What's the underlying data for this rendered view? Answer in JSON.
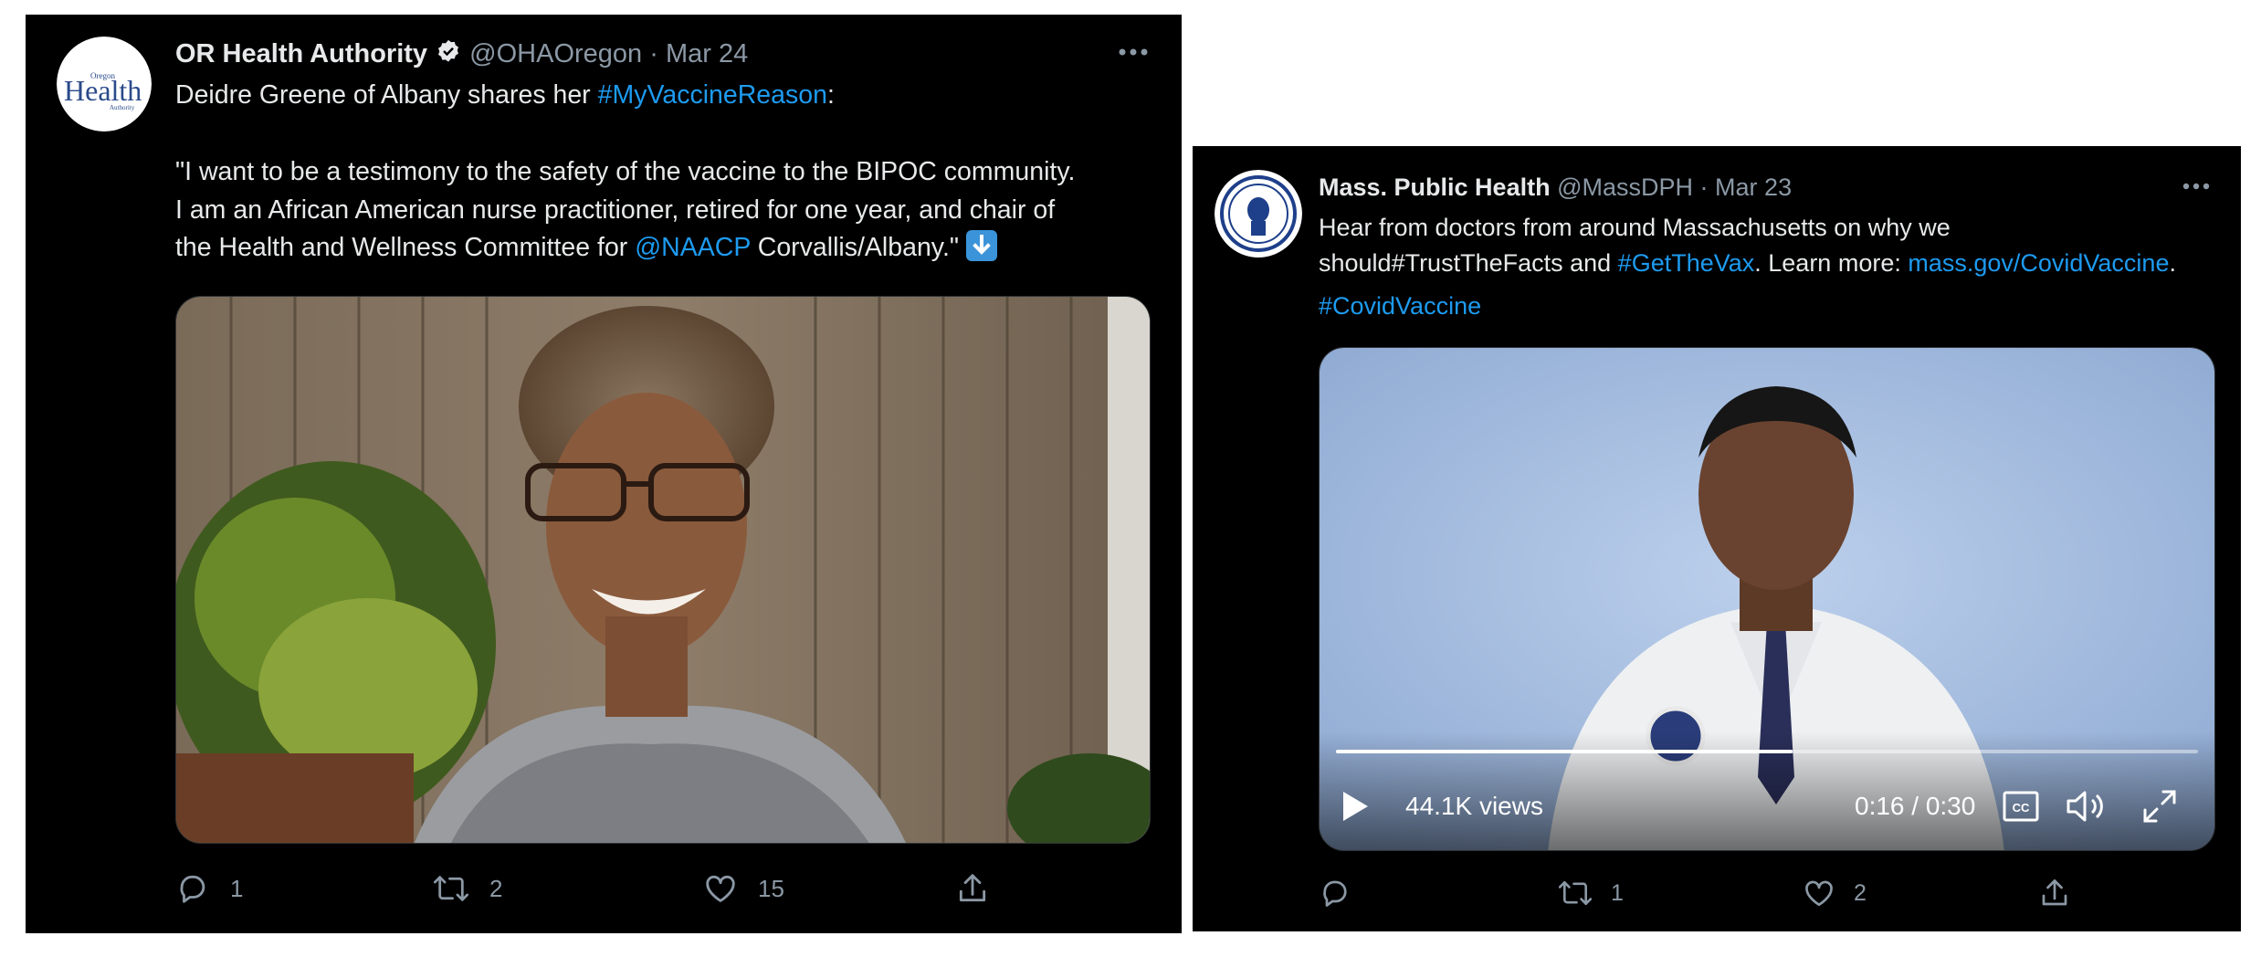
{
  "tweets": [
    {
      "author_name": "OR Health Authority",
      "handle": "@OHAOregon",
      "separator": "·",
      "date": "Mar 24",
      "avatar_lines": [
        "Oregon",
        "Health",
        "Authority"
      ],
      "text_line1_pre": "Deidre Greene of Albany shares her ",
      "hashtag1": "#MyVaccineReason",
      "text_line1_post": ":",
      "quote_line1": "\"I want to be a testimony to the safety of the vaccine to the BIPOC community.",
      "quote_line2": "I am an African American nurse practitioner, retired for one year, and chair of",
      "quote_line3_pre": "the Health and Wellness Committee for ",
      "mention": "@NAACP",
      "quote_line3_post": " Corvallis/Albany.\" ",
      "reply_count": "1",
      "retweet_count": "2",
      "like_count": "15"
    },
    {
      "author_name": "Mass. Public Health",
      "handle": "@MassDPH",
      "separator": "·",
      "date": "Mar 23",
      "text_line1": "Hear from doctors from around Massachusetts on why we",
      "text_line2_pre": "should#TrustTheFacts and ",
      "hashtag1": "#GetTheVax",
      "text_line2_mid": ". Learn more: ",
      "link": "mass.gov/CovidVaccine",
      "text_line2_post": ".",
      "hashtag2": "#CovidVaccine",
      "video": {
        "views": "44.1K views",
        "time": "0:16 / 0:30",
        "cc": "CC",
        "progress": 0.53
      },
      "reply_count": "",
      "retweet_count": "1",
      "like_count": "2"
    }
  ],
  "colors": {
    "background": "#000000",
    "link": "#1d9bf0",
    "muted": "#8b98a5",
    "text": "#e7e9ea"
  },
  "icons": [
    "verified-badge-icon",
    "more-icon",
    "reply-icon",
    "retweet-icon",
    "like-icon",
    "share-icon",
    "arrow-down-icon",
    "play-icon",
    "captions-icon",
    "volume-icon",
    "fullscreen-icon"
  ]
}
